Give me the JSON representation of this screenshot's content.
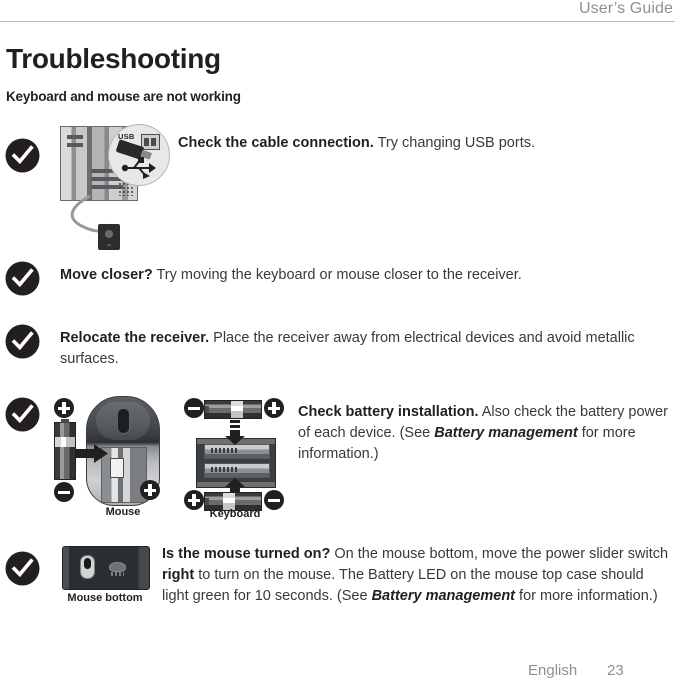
{
  "header": {
    "title": "User’s Guide"
  },
  "page_title": "Troubleshooting",
  "section_title": "Keyboard and mouse are not working",
  "tips": [
    {
      "id": "cable-connection",
      "bold_lead": "Check the cable connection.",
      "body": " Try changing USB ports.",
      "figure": "pc-usb-cable"
    },
    {
      "id": "move-closer",
      "bold_lead": "Move closer?",
      "body": " Try moving the keyboard or mouse closer to the receiver.",
      "figure": "none"
    },
    {
      "id": "relocate-receiver",
      "bold_lead": "Relocate the receiver.",
      "body": " Place the receiver away from electrical devices and avoid metallic surfaces.",
      "figure": "none"
    },
    {
      "id": "battery-installation",
      "bold_lead": "Check battery installation.",
      "body_1": " Also check the battery power of each device. (See ",
      "emphasis": "Battery management",
      "body_2": " for more information.)",
      "figure": "mouse-keyboard-batteries"
    },
    {
      "id": "mouse-power",
      "bold_lead": "Is the mouse turned on?",
      "body_1": " On the mouse bottom, move the power slider switch ",
      "emphasis_inline": "right",
      "body_2": " to turn on the mouse. The Battery LED on the mouse top case should light green for 10 seconds. (See ",
      "emphasis": "Battery management",
      "body_3": " for more information.)",
      "figure": "mouse-bottom"
    }
  ],
  "figures": {
    "usb_callout_label": "USB",
    "mouse_label": "Mouse",
    "keyboard_label": "Keyboard",
    "mouse_bottom_label": "Mouse bottom",
    "polarity": {
      "plus": "+",
      "minus": "−"
    },
    "mouse_battery": {
      "top_terminal": "+",
      "bottom_terminal": "−",
      "case_terminal": "+"
    },
    "keyboard_battery": {
      "top_left_terminal": "−",
      "top_right_terminal": "+",
      "bottom_left_terminal": "+",
      "bottom_right_terminal": "−"
    }
  },
  "footer": {
    "language": "English",
    "page_number": "23"
  },
  "colors": {
    "text": "#231f20",
    "body_text": "#3c3839",
    "muted": "#918f90",
    "rule": "#bcbabb",
    "badge": "#231f20"
  }
}
